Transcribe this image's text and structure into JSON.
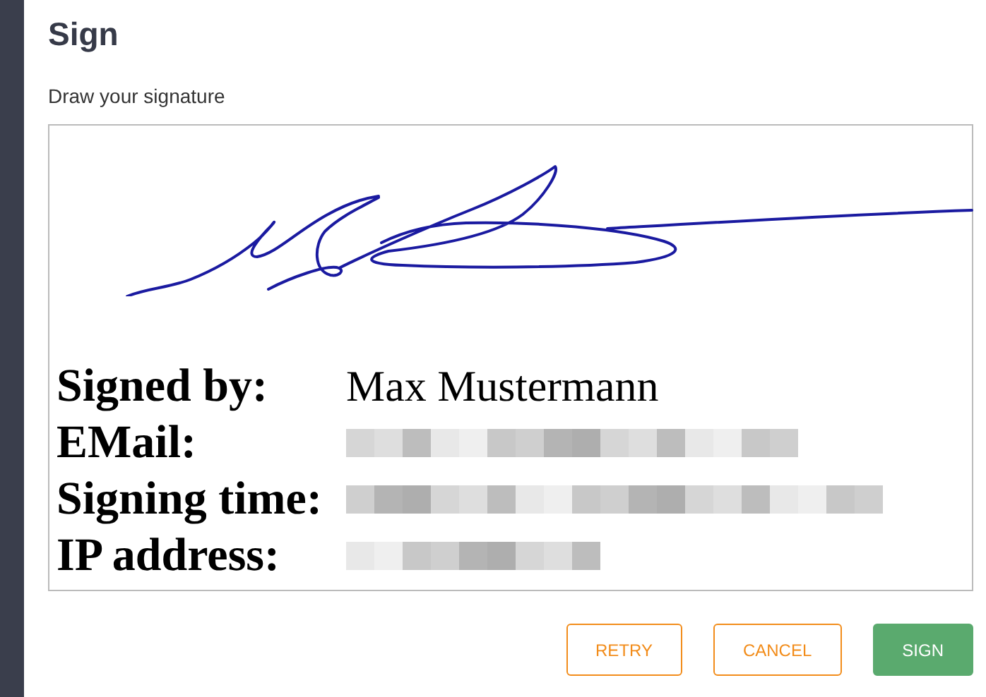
{
  "title": "Sign",
  "instruction": "Draw your signature",
  "signature_fields": [
    {
      "label": "Signed by:",
      "value": "Max Mustermann",
      "redacted": false
    },
    {
      "label": "EMail:",
      "redacted": true
    },
    {
      "label": "Signing time:",
      "redacted": true
    },
    {
      "label": "IP address:",
      "redacted": true
    }
  ],
  "buttons": [
    {
      "label": "RETRY",
      "kind": "outline"
    },
    {
      "label": "CANCEL",
      "kind": "outline"
    },
    {
      "label": "SIGN",
      "kind": "primary"
    }
  ]
}
